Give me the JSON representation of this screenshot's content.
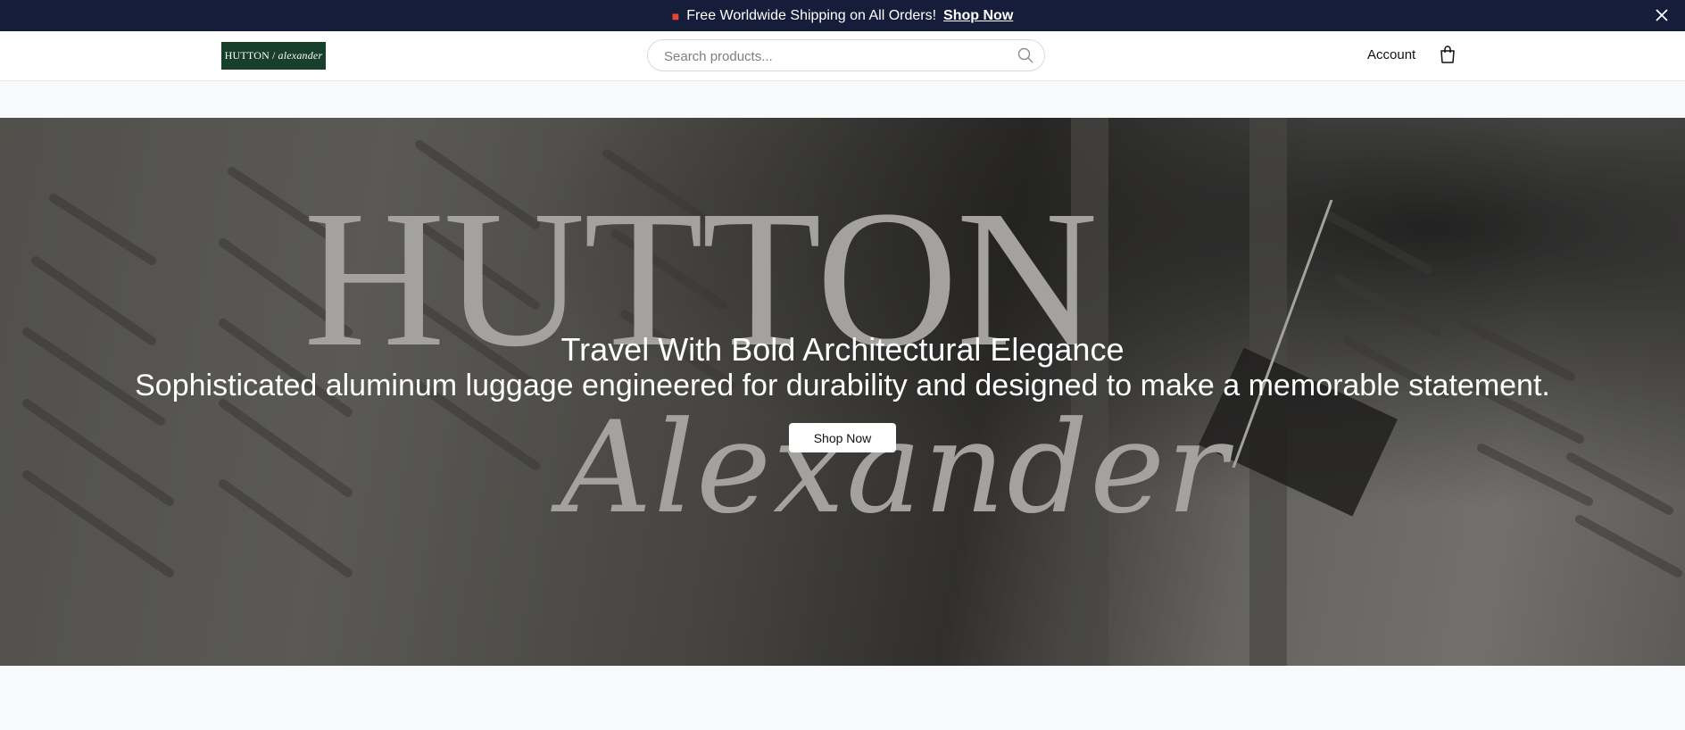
{
  "announcement": {
    "text": "Free Worldwide Shipping on All Orders!",
    "link": "Shop Now",
    "icon": "truck-icon",
    "close_icon": "close-icon"
  },
  "header": {
    "logo": {
      "left": "HUTTON",
      "slash": "/",
      "right": "alexander"
    },
    "search": {
      "placeholder": "Search products...",
      "icon": "search-icon"
    },
    "account": "Account",
    "cart_icon": "shopping-bag-icon"
  },
  "hero": {
    "brand_big": "HUTTON",
    "brand_slash": "/",
    "brand_script": "Alexander",
    "title": "Travel With Bold Architectural Elegance",
    "subtitle": "Sophisticated aluminum luggage engineered for durability and designed to make a memorable statement.",
    "cta": "Shop Now"
  },
  "colors": {
    "announcement_bg": "#151d3a",
    "logo_bg": "#173f2c",
    "page_bg": "#f8f9fb"
  }
}
